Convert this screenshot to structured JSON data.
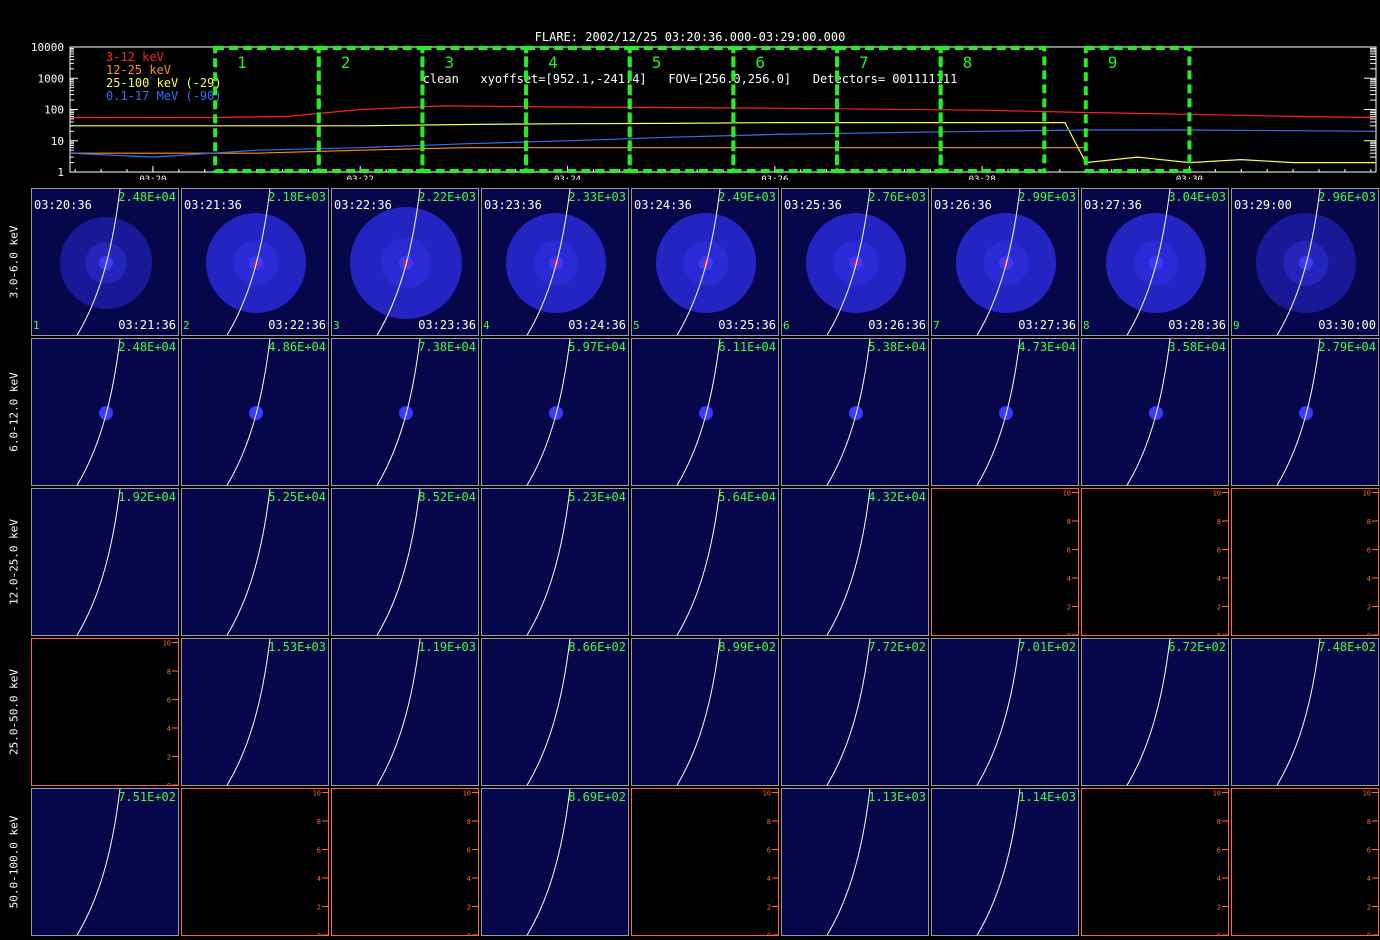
{
  "header": {
    "line1": "FLARE: 2002/12/25 03:20:36.000-03:29:00.000",
    "line2": "clean   xyoffset=[952.1,-241.4]   FOV=[256.0,256.0]   Detectors= 001111111"
  },
  "chart_data": {
    "type": "line",
    "yscale": "log",
    "ylim": [
      1,
      10000
    ],
    "y_ticks": [
      "1",
      "10",
      "100",
      "1000",
      "10000"
    ],
    "x_ticks": [
      "03:20",
      "03:22",
      "03:24",
      "03:26",
      "03:28",
      "03:30"
    ],
    "xlim_minutes": [
      19.2,
      31.8
    ],
    "legend_position": "top-left",
    "series": [
      {
        "name": "3-12 keV",
        "color": "#ff2020",
        "x": [
          19.2,
          20.5,
          21.3,
          22.0,
          22.8,
          24.0,
          26.0,
          28.0,
          29.0,
          30.0,
          31.0,
          31.8
        ],
        "y": [
          55,
          55,
          60,
          100,
          130,
          120,
          110,
          95,
          80,
          70,
          60,
          55
        ]
      },
      {
        "name": "12-25 keV",
        "color": "#ff8a20",
        "x": [
          19.2,
          21.0,
          22.0,
          23.0,
          24.0,
          25.0,
          26.0,
          27.0,
          28.0,
          29.0
        ],
        "y": [
          4,
          4,
          5,
          6,
          6,
          6,
          6,
          6,
          6,
          6
        ]
      },
      {
        "name": "25-100 keV (-29)",
        "color": "#ffff40",
        "x": [
          19.2,
          21.0,
          22.0,
          23.0,
          24.0,
          25.0,
          26.0,
          27.0,
          28.0,
          28.8,
          29.0,
          29.5,
          30.0,
          30.5,
          31.0,
          31.8
        ],
        "y": [
          30,
          30,
          30,
          33,
          35,
          36,
          38,
          38,
          38,
          38,
          2,
          3,
          2,
          2.5,
          2,
          2
        ]
      },
      {
        "name": "0.1-17 MeV (-90)",
        "color": "#3070ff",
        "x": [
          19.2,
          20.0,
          21.0,
          22.0,
          23.0,
          24.0,
          25.0,
          26.0,
          27.0,
          28.0,
          29.0,
          30.0,
          31.0,
          31.8
        ],
        "y": [
          4,
          3,
          5,
          6,
          8,
          10,
          13,
          16,
          18,
          20,
          22,
          22,
          21,
          20
        ]
      }
    ],
    "intervals": [
      {
        "label": "1",
        "t0": 20.6,
        "t1": 21.6
      },
      {
        "label": "2",
        "t0": 21.6,
        "t1": 22.6
      },
      {
        "label": "3",
        "t0": 22.6,
        "t1": 23.6
      },
      {
        "label": "4",
        "t0": 23.6,
        "t1": 24.6
      },
      {
        "label": "5",
        "t0": 24.6,
        "t1": 25.6
      },
      {
        "label": "6",
        "t0": 25.6,
        "t1": 26.6
      },
      {
        "label": "7",
        "t0": 26.6,
        "t1": 27.6
      },
      {
        "label": "8",
        "t0": 27.6,
        "t1": 28.6
      },
      {
        "label": "9",
        "t0": 29.0,
        "t1": 30.0
      }
    ]
  },
  "image_grid": {
    "energy_bands": [
      "3.0-6.0 keV",
      "6.0-12.0 keV",
      "12.0-25.0 keV",
      "25.0-50.0 keV",
      "50.0-100.0 keV"
    ],
    "start_times": [
      "03:20:36",
      "03:21:36",
      "03:22:36",
      "03:23:36",
      "03:24:36",
      "03:25:36",
      "03:26:36",
      "03:27:36",
      "03:29:00"
    ],
    "end_times": [
      "03:21:36",
      "03:22:36",
      "03:23:36",
      "03:24:36",
      "03:25:36",
      "03:26:36",
      "03:27:36",
      "03:28:36",
      "03:30:00"
    ],
    "interval_numbers": [
      "1",
      "2",
      "3",
      "4",
      "5",
      "6",
      "7",
      "8",
      "9"
    ],
    "peaks": [
      [
        "2.48E+04",
        "2.18E+03",
        "2.22E+03",
        "2.33E+03",
        "2.49E+03",
        "2.76E+03",
        "2.99E+03",
        "3.04E+03",
        "2.96E+03"
      ],
      [
        "2.48E+04",
        "4.86E+04",
        "7.38E+04",
        "5.97E+04",
        "6.11E+04",
        "5.38E+04",
        "4.73E+04",
        "3.58E+04",
        "2.79E+04"
      ],
      [
        "1.92E+04",
        "5.25E+04",
        "8.52E+04",
        "5.23E+04",
        "5.64E+04",
        "4.32E+04",
        "",
        "",
        ""
      ],
      [
        "",
        "1.53E+03",
        "1.19E+03",
        "8.66E+02",
        "8.99E+02",
        "7.72E+02",
        "7.01E+02",
        "6.72E+02",
        "7.48E+02"
      ],
      [
        "7.51E+02",
        "",
        "",
        "8.69E+02",
        "",
        "1.13E+03",
        "1.14E+03",
        "",
        ""
      ]
    ],
    "empty_axis_ticks": [
      "0",
      "2",
      "4",
      "6",
      "8",
      "10"
    ],
    "colors": {
      "image_background": "#06064a",
      "disk": "#2a2ad8",
      "source_core": "#c02060",
      "limb_line": "#ffffff",
      "peak_text": "#3cff3c",
      "empty_axis": "#ff6a2a",
      "interval_box": "#22ee22"
    }
  }
}
